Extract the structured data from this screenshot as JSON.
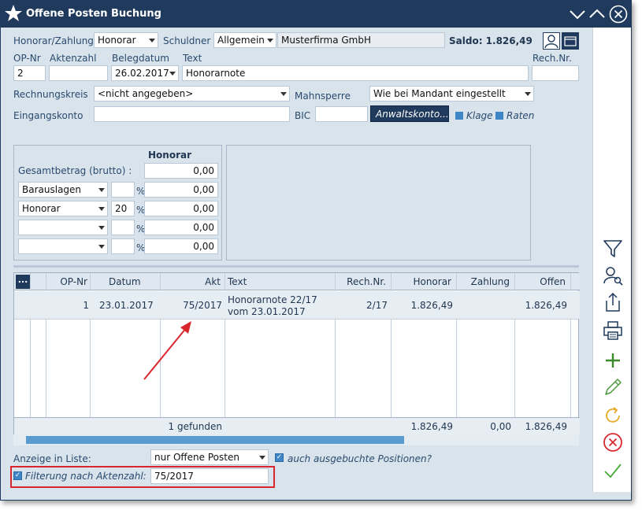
{
  "window": {
    "title": "Offene Posten Buchung"
  },
  "row1": {
    "honorar_zahlung_label": "Honorar/Zahlung",
    "honorar_zahlung_value": "Honorar",
    "schuldner_label": "Schuldner",
    "schuldner_type": "Allgemein",
    "schuldner_name": "Musterfirma GmbH",
    "saldo_label": "Saldo: 1.826,49"
  },
  "row2": {
    "op_nr_label": "OP-Nr",
    "aktenzahl_label": "Aktenzahl",
    "belegdatum_label": "Belegdatum",
    "text_label": "Text",
    "rech_nr_label": "Rech.Nr.",
    "op_nr_value": "2",
    "aktenzahl_value": "",
    "belegdatum_value": "26.02.2017",
    "text_value": "Honorarnote",
    "rech_nr_value": ""
  },
  "row3": {
    "rechnungskreis_label": "Rechnungskreis",
    "rechnungskreis_value": "<nicht angegeben>",
    "mahnsperre_label": "Mahnsperre",
    "mahnsperre_value": "Wie bei Mandant eingestellt"
  },
  "row4": {
    "eingangskonto_label": "Eingangskonto",
    "eingangskonto_value": "",
    "bic_label": "BIC",
    "bic_value": "",
    "anwaltskonto_button": "Anwaltskonto...",
    "klage_label": "Klage",
    "raten_label": "Raten"
  },
  "amounts": {
    "header": "Honorar",
    "gesamtbetrag_label": "Gesamtbetrag (brutto) :",
    "gesamtbetrag_value": "0,00",
    "rows": [
      {
        "type": "Barauslagen",
        "pct": "",
        "pct_sign": "%",
        "value": "0,00"
      },
      {
        "type": "Honorar",
        "pct": "20",
        "pct_sign": "%",
        "value": "0,00"
      },
      {
        "type": "",
        "pct": "",
        "pct_sign": "%",
        "value": "0,00"
      },
      {
        "type": "",
        "pct": "",
        "pct_sign": "%",
        "value": "0,00"
      }
    ]
  },
  "table": {
    "menu_button": "...",
    "columns": [
      "OP-Nr",
      "Datum",
      "Akt",
      "Text",
      "Rech.Nr.",
      "Honorar",
      "Zahlung",
      "Offen"
    ],
    "rows": [
      {
        "op_nr": "1",
        "datum": "23.01.2017",
        "akt": "75/2017",
        "text_line1": "Honorarnote 22/17",
        "text_line2": "vom 23.01.2017",
        "rech_nr": "2/17",
        "honorar": "1.826,49",
        "zahlung": "",
        "offen": "1.826,49"
      }
    ],
    "footer": {
      "found": "1 gefunden",
      "honorar": "1.826,49",
      "zahlung": "0,00",
      "offen": "1.826,49"
    }
  },
  "bottom": {
    "anzeige_label": "Anzeige in Liste:",
    "anzeige_value": "nur Offene Posten",
    "ausgebucht_label": "auch ausgebuchte Positionen?",
    "filter_label": "Filterung nach Aktenzahl:",
    "filter_value": "75/2017"
  },
  "colors": {
    "titlebar": "#1f3a5c",
    "accent": "#3f86c6",
    "highlight": "#d9262c",
    "window_bg": "#d8e3ec"
  },
  "icons": [
    "star-icon",
    "minimize-icon",
    "maximize-icon",
    "close-icon",
    "person-icon",
    "folder-icon",
    "filter-icon",
    "person-search-icon",
    "export-icon",
    "print-icon",
    "plus-icon",
    "pencil-icon",
    "refresh-icon",
    "cancel-icon",
    "check-icon"
  ]
}
